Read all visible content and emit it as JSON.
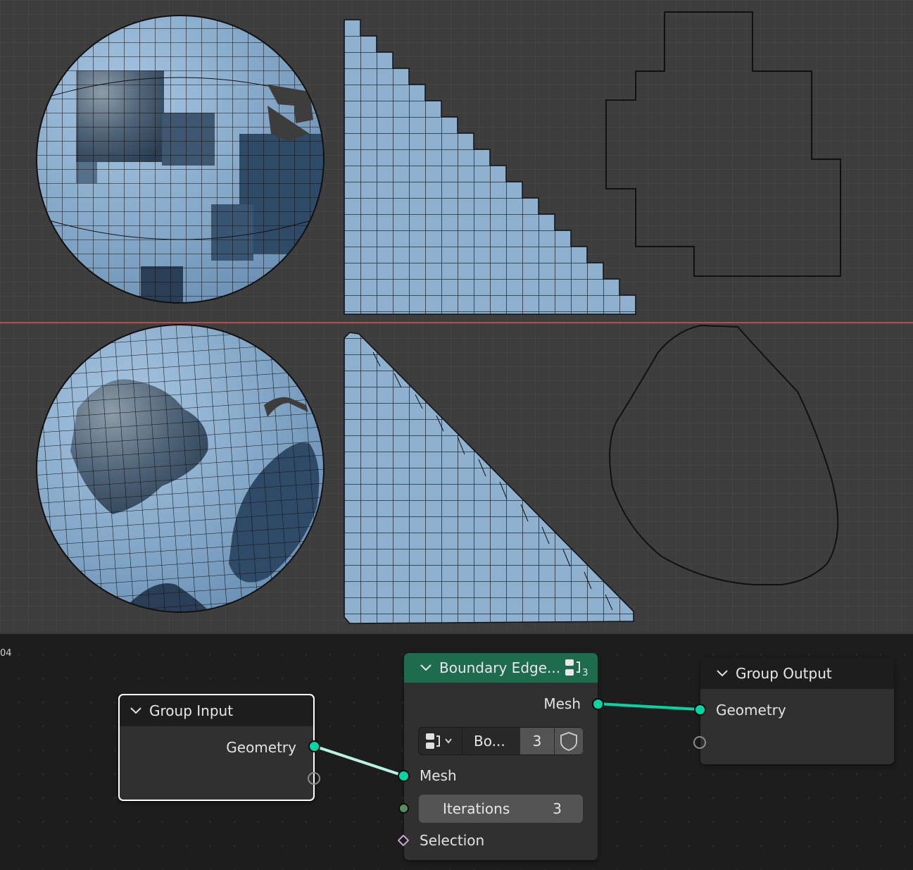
{
  "viewport": {
    "colors": {
      "mesh_fill": "#8fb1d0",
      "mesh_dark": "#2f4a66",
      "edge": "#111111",
      "axis_line": "#c9454c"
    }
  },
  "editor": {
    "corner_label": "04",
    "nodes": {
      "group_input": {
        "title": "Group Input",
        "output": "Geometry"
      },
      "boundary": {
        "title": "Boundary Edge...",
        "badge": "3",
        "output": "Mesh",
        "mode_label": "Bo...",
        "mode_count": "3",
        "input_mesh": "Mesh",
        "iterations_label": "Iterations",
        "iterations_value": "3",
        "selection": "Selection"
      },
      "group_output": {
        "title": "Group Output",
        "input": "Geometry"
      }
    },
    "colors": {
      "header_green": "#1f6b50",
      "header_dark": "#1d1d1d",
      "geo_socket": "#00d6a3",
      "wire": "#00d6a3",
      "wire_selected": "#b8f3e3"
    }
  }
}
